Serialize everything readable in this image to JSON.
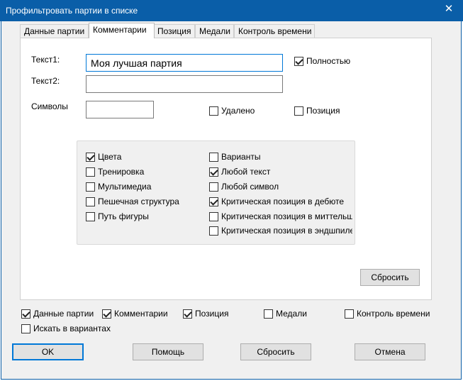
{
  "window": {
    "title": "Профильтровать партии в списке",
    "close_symbol": "✕"
  },
  "tabs": [
    {
      "label": "Данные партии",
      "active": false
    },
    {
      "label": "Комментарии",
      "active": true
    },
    {
      "label": "Позиция",
      "active": false
    },
    {
      "label": "Медали",
      "active": false
    },
    {
      "label": "Контроль времени",
      "active": false
    }
  ],
  "comments": {
    "text1_label": "Текст1:",
    "text1_value": "Моя лучшая партия",
    "text2_label": "Текст2:",
    "text2_value": "",
    "symbols_label": "Символы",
    "symbols_value": "",
    "full_label": "Полностью",
    "full_checked": true,
    "deleted_label": "Удалено",
    "deleted_checked": false,
    "position_label": "Позиция",
    "position_checked": false,
    "options_left": [
      {
        "label": "Цвета",
        "checked": true
      },
      {
        "label": "Тренировка",
        "checked": false
      },
      {
        "label": "Мультимедиа",
        "checked": false
      },
      {
        "label": "Пешечная структура",
        "checked": false
      },
      {
        "label": "Путь фигуры",
        "checked": false
      }
    ],
    "options_right": [
      {
        "label": "Варианты",
        "checked": false
      },
      {
        "label": "Любой текст",
        "checked": true
      },
      {
        "label": "Любой символ",
        "checked": false
      },
      {
        "label": "Критическая позиция в дебюте",
        "checked": true
      },
      {
        "label": "Критическая позиция в миттельшпиле",
        "checked": false
      },
      {
        "label": "Критическая позиция в эндшпиле",
        "checked": false
      }
    ],
    "reset_label": "Сбросить"
  },
  "scope": {
    "items": [
      {
        "label": "Данные партии",
        "checked": true
      },
      {
        "label": "Комментарии",
        "checked": true
      },
      {
        "label": "Позиция",
        "checked": true
      },
      {
        "label": "Медали",
        "checked": false
      },
      {
        "label": "Контроль времени",
        "checked": false
      }
    ],
    "search_variants_label": "Искать в вариантах",
    "search_variants_checked": false
  },
  "buttons": {
    "ok": "OK",
    "help": "Помощь",
    "reset": "Сбросить",
    "cancel": "Отмена"
  },
  "colors": {
    "titlebar": "#0a5ea8",
    "dialog_bg": "#f0f0f0",
    "focus_border": "#0078d7"
  }
}
